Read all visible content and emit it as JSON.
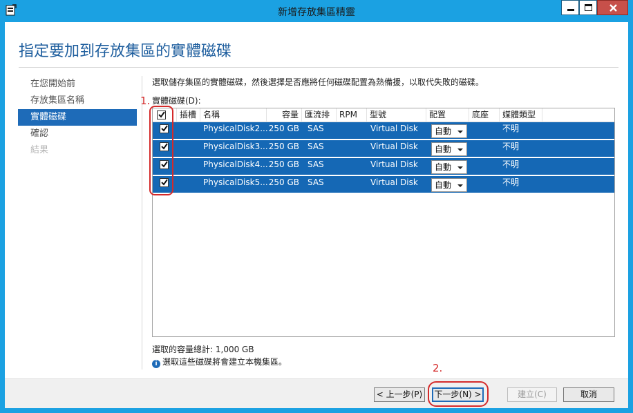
{
  "window": {
    "title": "新增存放集區精靈",
    "icon": "wizard-app-icon",
    "controls": [
      "minimize-icon",
      "maximize-icon",
      "close-icon"
    ]
  },
  "header": {
    "title": "指定要加到存放集區的實體磁碟"
  },
  "nav": {
    "items": [
      {
        "label": "在您開始前",
        "state": "normal"
      },
      {
        "label": "存放集區名稱",
        "state": "normal"
      },
      {
        "label": "實體磁碟",
        "state": "active"
      },
      {
        "label": "確認",
        "state": "normal"
      },
      {
        "label": "結果",
        "state": "disabled"
      }
    ]
  },
  "content": {
    "instruction": "選取儲存集區的實體磁碟，然後選擇是否應將任何磁碟配置為熱備援，以取代失敗的磁碟。",
    "group_label": "實體磁碟(D):",
    "columns": [
      "插槽",
      "名稱",
      "容量",
      "匯流排",
      "RPM",
      "型號",
      "配置",
      "底座",
      "媒體類型"
    ],
    "header_checked": true,
    "disks": [
      {
        "checked": true,
        "slot": "",
        "name": "PhysicalDisk2...",
        "capacity": "250 GB",
        "bus": "SAS",
        "rpm": "",
        "model": "Virtual Disk",
        "allocation": "自動",
        "chassis": "",
        "media_type": "不明"
      },
      {
        "checked": true,
        "slot": "",
        "name": "PhysicalDisk3...",
        "capacity": "250 GB",
        "bus": "SAS",
        "rpm": "",
        "model": "Virtual Disk",
        "allocation": "自動",
        "chassis": "",
        "media_type": "不明"
      },
      {
        "checked": true,
        "slot": "",
        "name": "PhysicalDisk4...",
        "capacity": "250 GB",
        "bus": "SAS",
        "rpm": "",
        "model": "Virtual Disk",
        "allocation": "自動",
        "chassis": "",
        "media_type": "不明"
      },
      {
        "checked": true,
        "slot": "",
        "name": "PhysicalDisk5...",
        "capacity": "250 GB",
        "bus": "SAS",
        "rpm": "",
        "model": "Virtual Disk",
        "allocation": "自動",
        "chassis": "",
        "media_type": "不明"
      }
    ],
    "total_capacity_label": "選取的容量總計:",
    "total_capacity_value": "1,000 GB",
    "info_text": "選取這些磁碟將會建立本機集區。"
  },
  "annotations": {
    "step1": "1.",
    "step2": "2."
  },
  "footer": {
    "back": "< 上一步(P)",
    "next": "下一步(N) >",
    "install": "建立(C)",
    "cancel": "取消"
  },
  "colors": {
    "title_bar": "#1ba1e2",
    "selection": "#1568b5",
    "nav_active": "#1e6bb8",
    "title_text": "#1e5e9e",
    "annotation": "#d42a2a"
  }
}
